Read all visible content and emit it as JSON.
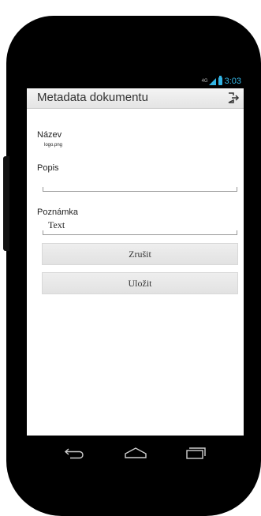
{
  "status": {
    "network": "4G",
    "time": "3:03"
  },
  "app": {
    "title": "Metadata dokumentu",
    "exit_icon": "exit-icon"
  },
  "form": {
    "name_label": "Název",
    "name_value": "logo.png",
    "description_label": "Popis",
    "description_value": "",
    "note_label": "Poznámka",
    "note_value": "Text"
  },
  "buttons": {
    "cancel": "Zrušit",
    "save": "Uložit"
  },
  "nav": {
    "back_icon": "back-icon",
    "home_icon": "home-icon",
    "recents_icon": "recent-apps-icon"
  },
  "colors": {
    "accent": "#33b5e5",
    "bezel": "#000000"
  }
}
